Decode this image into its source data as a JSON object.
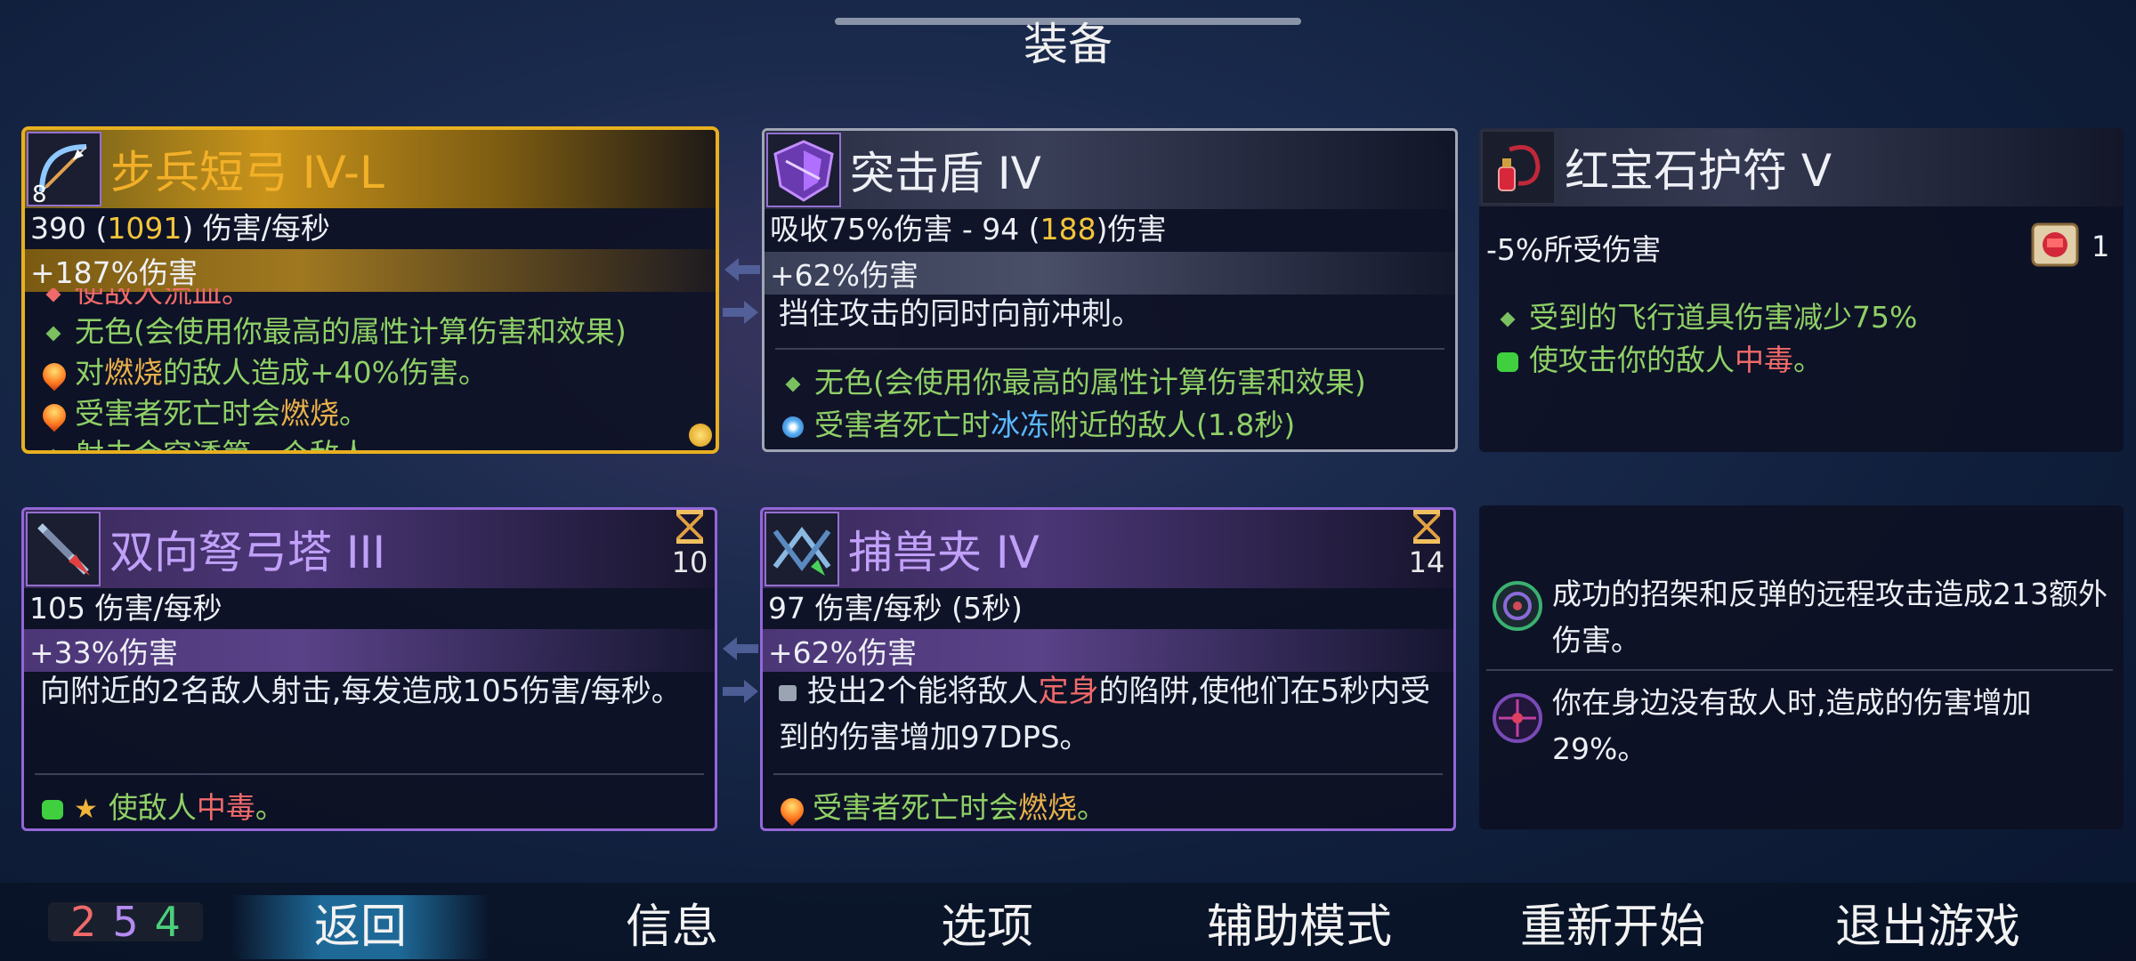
{
  "screen": {
    "title": "装备"
  },
  "colors": {
    "gold": "#e8b020",
    "purple": "#9466d8",
    "gray_border": "#a0a6b4",
    "yellow_value": "#f2c43a",
    "green_text": "#8fd066",
    "orange_text": "#e8b04a",
    "blue_text": "#5ab8ff",
    "red_text": "#f06a6a"
  },
  "items": [
    {
      "name": "步兵短弓 IV-L",
      "icon": "bow-icon",
      "icon_badge": "8",
      "stat_line1": [
        "390 (",
        "1091",
        ") 伤害/每秒"
      ],
      "stat_line2": "+187%伤害",
      "cut_top": "使敌人流血。",
      "effects": [
        {
          "icon": "diamond-bullet-icon",
          "text": "无色(会使用你最高的属性计算伤害和效果)"
        },
        {
          "icon": "fire-icon",
          "pre": "对",
          "hl": "燃烧",
          "post": "的敌人造成+40%伤害。"
        },
        {
          "icon": "fire-icon",
          "pre": "受害者死亡时会",
          "hl": "燃烧",
          "post": "。"
        }
      ],
      "cut_bottom": "射击会穿透第一个敌人。"
    },
    {
      "name": "突击盾 IV",
      "icon": "shield-icon",
      "stat_line1": [
        "吸收75%伤害 - 94 (",
        "188",
        ")伤害"
      ],
      "stat_line2": "+62%伤害",
      "desc": "挡住攻击的同时向前冲刺。",
      "effects": [
        {
          "icon": "diamond-bullet-icon",
          "text": "无色(会使用你最高的属性计算伤害和效果)"
        },
        {
          "icon": "ice-icon",
          "pre": "受害者死亡时",
          "hl": "冰冻",
          "post": "附近的敌人(1.8秒)"
        }
      ]
    },
    {
      "name": "红宝石护符 V",
      "icon": "amulet-icon",
      "stat_line1": "-5%所受伤害",
      "scroll_icon": "scroll-fist-icon",
      "scroll_count": "1",
      "effects": [
        {
          "icon": "diamond-bullet-icon",
          "text": "受到的飞行道具伤害减少75%"
        },
        {
          "icon": "poison-icon",
          "pre": "使攻击你的敌人",
          "hl": "中毒",
          "post": "。"
        }
      ]
    },
    {
      "name": "双向弩弓塔 III",
      "icon": "crossbow-turret-icon",
      "cooldown": "10",
      "stat_line1": "105 伤害/每秒",
      "stat_line2": "+33%伤害",
      "desc": "向附近的2名敌人射击,每发造成105伤害/每秒。",
      "effects": [
        {
          "icon": "poison-star-icon",
          "pre": "使敌人",
          "hl": "中毒",
          "post": "。"
        }
      ]
    },
    {
      "name": "捕兽夹 IV",
      "icon": "trap-icon",
      "cooldown": "14",
      "stat_line1": "97 伤害/每秒 (5秒)",
      "stat_line2": "+62%伤害",
      "desc_pre": "投出2个能将敌人",
      "desc_hl": "定身",
      "desc_post": "的陷阱,使他们在5秒内受到的伤害增加97DPS。",
      "effects": [
        {
          "icon": "fire-icon",
          "pre": "受害者死亡时会",
          "hl": "燃烧",
          "post": "。"
        }
      ]
    }
  ],
  "mutations": [
    {
      "icon": "parry-ring-icon",
      "text": "成功的招架和反弹的远程攻击造成213额外伤害。"
    },
    {
      "icon": "crosshair-icon",
      "text": "你在身边没有敌人时,造成的伤害增加29%。"
    }
  ],
  "scrolls": {
    "red": "2",
    "purple": "5",
    "green": "4"
  },
  "menu": {
    "back": "返回",
    "info": "信息",
    "options": "选项",
    "assist": "辅助模式",
    "restart": "重新开始",
    "quit": "退出游戏"
  }
}
